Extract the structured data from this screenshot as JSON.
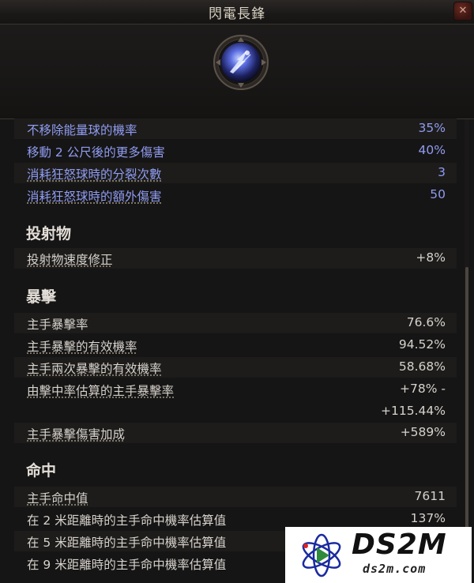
{
  "window": {
    "title": "閃電長鋒",
    "close_glyph": "✕"
  },
  "skill_icon": {
    "name": "lightning-spear-icon",
    "accent": "#7d8cf0"
  },
  "modifiers": [
    {
      "label": "不移除能量球的機率",
      "value": "35%"
    },
    {
      "label": "移動 2 公尺後的更多傷害",
      "value": "40%"
    },
    {
      "label": "消耗狂怒球時的分裂次數",
      "value": "3"
    },
    {
      "label": "消耗狂怒球時的額外傷害",
      "value": "50"
    }
  ],
  "sections": {
    "projectile": {
      "heading": "投射物",
      "rows": [
        {
          "label": "投射物速度修正",
          "value": "+8%"
        }
      ]
    },
    "critical": {
      "heading": "暴擊",
      "rows": [
        {
          "label": "主手暴擊率",
          "value": "76.6%"
        },
        {
          "label": "主手暴擊的有效機率",
          "value": "94.52%"
        },
        {
          "label": "主手兩次暴擊的有效機率",
          "value": "58.68%"
        },
        {
          "label": "由擊中率估算的主手暴擊率",
          "value": "+78% -",
          "value2": "+115.44%"
        },
        {
          "label": "主手暴擊傷害加成",
          "value": "+589%"
        }
      ]
    },
    "accuracy": {
      "heading": "命中",
      "rows": [
        {
          "label": "主手命中值",
          "value": "7611"
        },
        {
          "label": "在 2 米距離時的主手命中機率估算值",
          "value": "137%"
        },
        {
          "label": "在 5 米距離時的主手命中機率估算值",
          "value": ""
        },
        {
          "label": "在 9 米距離時的主手命中機率估算值",
          "value": ""
        }
      ]
    }
  },
  "watermark": {
    "brand": "DS2M",
    "url": "ds2m.com"
  },
  "colors": {
    "modifier_text": "#8f9cf0",
    "stat_text": "#d6d2cc",
    "background": "#161515"
  }
}
